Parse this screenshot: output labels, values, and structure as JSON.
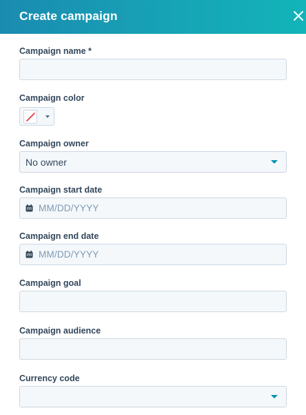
{
  "header": {
    "title": "Create campaign",
    "close_icon": "close-icon",
    "gradient_colors": [
      "#1a8bb0",
      "#12b4b9"
    ]
  },
  "form": {
    "name": {
      "label": "Campaign name *",
      "value": ""
    },
    "color": {
      "label": "Campaign color",
      "selected": "none",
      "swatch_icon": "no-color-slash-icon"
    },
    "owner": {
      "label": "Campaign owner",
      "value": "No owner"
    },
    "start_date": {
      "label": "Campaign start date",
      "placeholder": "MM/DD/YYYY",
      "icon": "calendar-icon"
    },
    "end_date": {
      "label": "Campaign end date",
      "placeholder": "MM/DD/YYYY",
      "icon": "calendar-icon"
    },
    "goal": {
      "label": "Campaign goal",
      "value": ""
    },
    "audience": {
      "label": "Campaign audience",
      "value": ""
    },
    "currency": {
      "label": "Currency code",
      "value": ""
    }
  },
  "colors": {
    "accent": "#0091ae",
    "text": "#33475b",
    "input_bg": "#f5f8fa",
    "input_border": "#cbd6e2",
    "placeholder": "#7c98b6"
  }
}
